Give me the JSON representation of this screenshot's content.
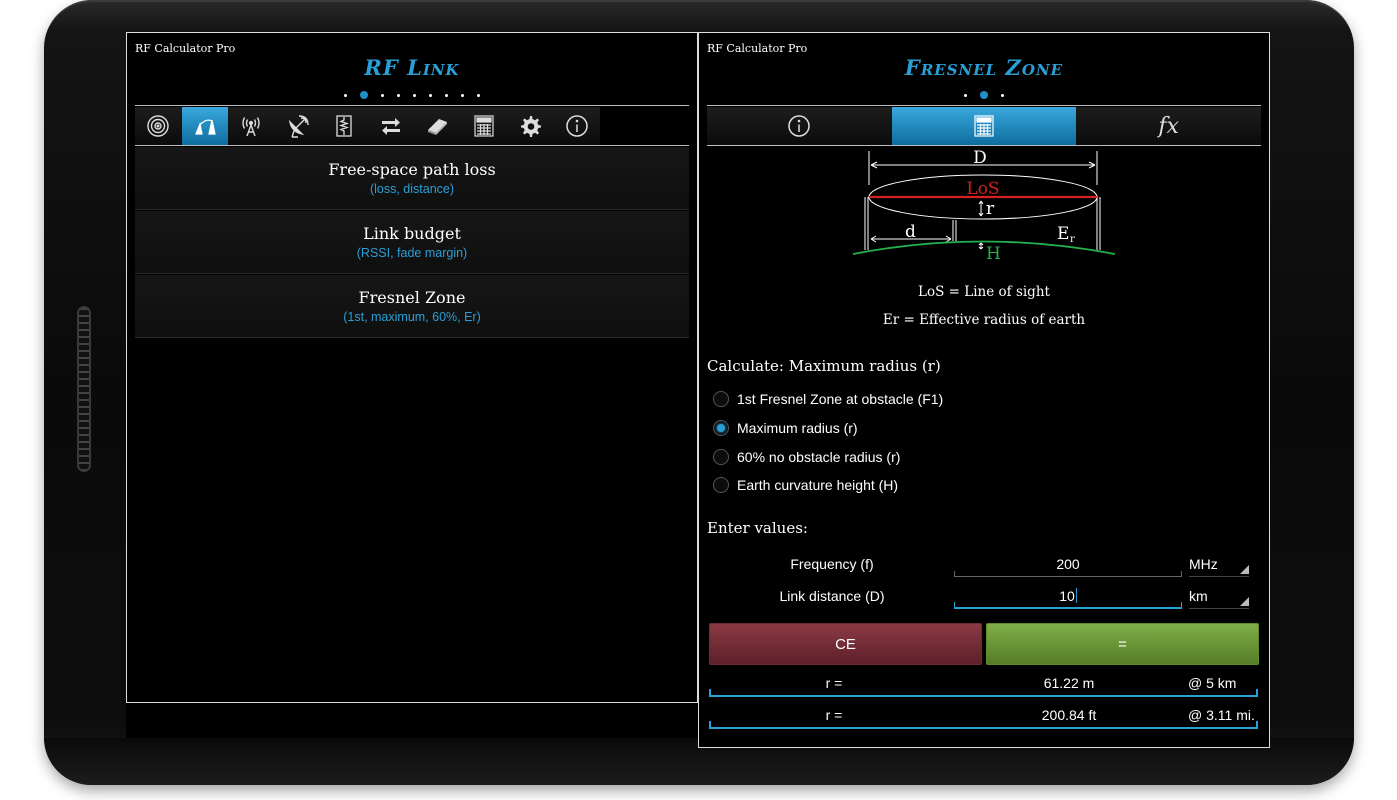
{
  "app_name": "RF Calculator Pro",
  "left_pane": {
    "title": "RF Link",
    "page_dots": 9,
    "active_dot": 1,
    "toolbar_icons": [
      "antenna-icon",
      "link-icon",
      "broadcast-icon",
      "satellite-dish-icon",
      "resistor-icon",
      "transfer-icon",
      "book-icon",
      "calculator-icon",
      "gear-icon",
      "info-icon"
    ],
    "active_toolbar_index": 1,
    "items": [
      {
        "title": "Free-space path loss",
        "subtitle": "(loss, distance)"
      },
      {
        "title": "Link budget",
        "subtitle": "(RSSI, fade margin)"
      },
      {
        "title": "Fresnel Zone",
        "subtitle": "(1st, maximum, 60%, Er)"
      }
    ]
  },
  "right_pane": {
    "title": "Fresnel Zone",
    "page_dots": 3,
    "active_dot": 1,
    "tabs": [
      "info-icon",
      "calculator-icon",
      "fx-icon"
    ],
    "fx_label": "fx",
    "active_tab_index": 1,
    "diagram": {
      "D": "D",
      "LoS": "LoS",
      "r": "r",
      "d": "d",
      "Er": "E",
      "Er_sub": "r",
      "H": "H"
    },
    "caption_los": "LoS = Line of sight",
    "caption_er": "Er = Effective radius of earth",
    "calculate_label": "Calculate: Maximum radius (r)",
    "options": [
      {
        "label": "1st Fresnel Zone at obstacle (F1)",
        "checked": false
      },
      {
        "label": "Maximum radius (r)",
        "checked": true
      },
      {
        "label": "60% no obstacle radius (r)",
        "checked": false
      },
      {
        "label": "Earth curvature height (H)",
        "checked": false
      }
    ],
    "enter_values_label": "Enter values:",
    "fields": [
      {
        "label": "Frequency (f)",
        "value": "200",
        "unit": "MHz"
      },
      {
        "label": "Link distance (D)",
        "value": "10",
        "unit": "km"
      }
    ],
    "ce_label": "CE",
    "equals_label": "=",
    "results": [
      {
        "label": "r =",
        "value": "61.22 m",
        "extra": "@ 5 km"
      },
      {
        "label": "r =",
        "value": "200.84 ft",
        "extra": "@ 3.11 mi."
      }
    ]
  },
  "colors": {
    "accent": "#2a9fd6",
    "ce": "#7a2f3a",
    "equals": "#6b9a3a",
    "los_red": "#d42020",
    "earth_green": "#22b14c"
  }
}
